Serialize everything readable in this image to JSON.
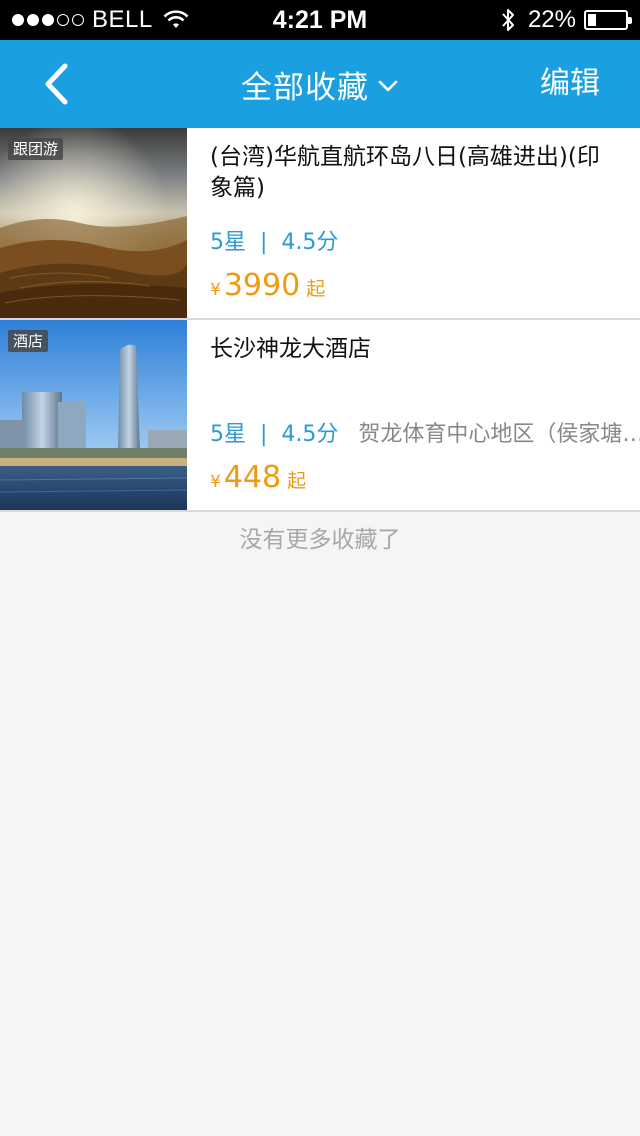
{
  "status_bar": {
    "carrier": "BELL",
    "signal_bars_filled": 3,
    "signal_bars_total": 5,
    "time": "4:21 PM",
    "battery_percent": "22%",
    "battery_level": 0.22
  },
  "nav": {
    "title": "全部收藏",
    "edit_label": "编辑"
  },
  "favorites": [
    {
      "tag": "跟团游",
      "title": "(台湾)华航直航环岛八日(高雄进出)(印象篇)",
      "stars": "5星",
      "separator": "|",
      "score": "4.5分",
      "location": "",
      "currency": "¥",
      "price": "3990",
      "price_suffix": "起"
    },
    {
      "tag": "酒店",
      "title": "长沙神龙大酒店",
      "stars": "5星",
      "separator": "|",
      "score": "4.5分",
      "location": "贺龙体育中心地区（侯家塘…",
      "currency": "¥",
      "price": "448",
      "price_suffix": "起"
    }
  ],
  "footer": {
    "no_more": "没有更多收藏了"
  },
  "colors": {
    "nav_bg": "#1a9fe0",
    "rating_blue": "#2a9bd5",
    "price_orange": "#f09a13",
    "page_bg": "#f5f5f5"
  }
}
